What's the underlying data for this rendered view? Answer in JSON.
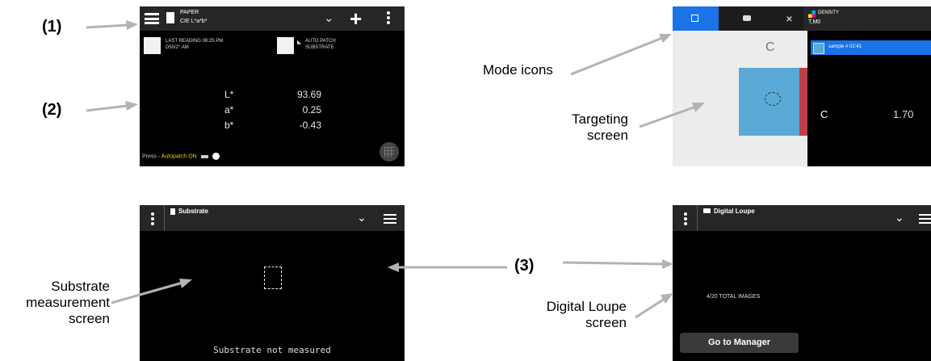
{
  "annotations": {
    "n1": "(1)",
    "n2": "(2)",
    "n3": "(3)",
    "mode_icons": "Mode icons",
    "targeting_1": "Targeting",
    "targeting_2": "screen",
    "substrate_1": "Substrate",
    "substrate_2": "measurement",
    "substrate_3": "screen",
    "loupe_1": "Digital Loupe",
    "loupe_2": "screen"
  },
  "screen1": {
    "title": "PAPER",
    "subtitle": "CIE L*a*b*",
    "last_reading": "LAST READING 08:25 PM",
    "last_reading_sub": "D50/2° AM",
    "auto_patch": "AUTO PATCH",
    "auto_patch_sub": "SUBSTRATE",
    "values": [
      {
        "label": "L*",
        "value": "93.69"
      },
      {
        "label": "a*",
        "value": "0.25"
      },
      {
        "label": "b*",
        "value": "-0.43"
      }
    ],
    "footer_press": "Press - ",
    "footer_autopatch": "Autopatch ON"
  },
  "screen2": {
    "tab_x": "×",
    "mode_title": "DENSITY",
    "mode_subtitle": "T,M0",
    "target_letter": "C",
    "sample_label": "sample # 02:41",
    "channel": "C",
    "channel_value": "1.70"
  },
  "screen3": {
    "title": "Substrate",
    "message": "Substrate not measured"
  },
  "screen4": {
    "title": "Digital Loupe",
    "images": "4/20 TOTAL IMAGES",
    "button": "Go to Manager"
  },
  "colors": {
    "accent_blue": "#1a73e8",
    "cyan_patch": "#5aa9d6",
    "autopatch_yellow": "#f0d000",
    "arrow_gray": "#b3b3b3"
  }
}
